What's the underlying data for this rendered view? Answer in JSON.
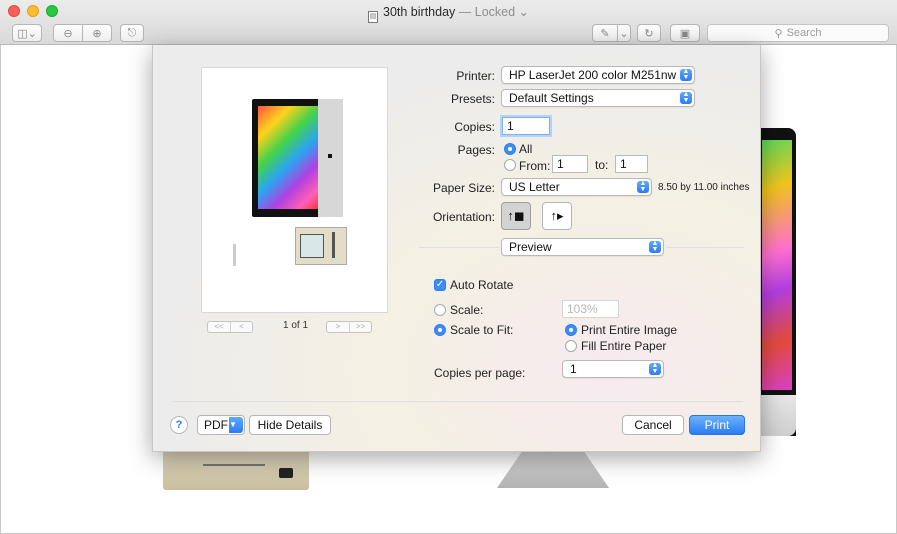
{
  "window": {
    "title": "30th birthday",
    "title_suffix": "— Locked ⌄",
    "search_placeholder": "Search"
  },
  "toolbar": {
    "sidebar_icon": "sidebar-icon",
    "zoom_out_icon": "zoom-out-icon",
    "zoom_in_icon": "zoom-in-icon",
    "share_icon": "share-icon",
    "markup_icon": "pen-icon",
    "rotate_icon": "rotate-icon",
    "toolbox_icon": "toolbox-icon"
  },
  "preview": {
    "page_count": "1 of 1",
    "first_page": "<<",
    "prev_page": "<",
    "next_page": ">",
    "last_page": ">>"
  },
  "print_dialog": {
    "printer_label": "Printer:",
    "printer_value": "HP LaserJet 200 color M251nw",
    "presets_label": "Presets:",
    "presets_value": "Default Settings",
    "copies_label": "Copies:",
    "copies_value": "1",
    "pages_label": "Pages:",
    "pages_all": "All",
    "pages_from_label": "From:",
    "pages_from_value": "1",
    "pages_to_label": "to:",
    "pages_to_value": "1",
    "paper_size_label": "Paper Size:",
    "paper_size_value": "US Letter",
    "paper_size_dimensions": "8.50 by 11.00 inches",
    "orientation_label": "Orientation:",
    "section_value": "Preview",
    "auto_rotate_label": "Auto Rotate",
    "scale_label": "Scale:",
    "scale_value": "103%",
    "scale_to_fit_label": "Scale to Fit:",
    "print_entire_image": "Print Entire Image",
    "fill_entire_paper": "Fill Entire Paper",
    "copies_per_page_label": "Copies per page:",
    "copies_per_page_value": "1",
    "help_label": "?",
    "pdf_label": "PDF",
    "hide_details_label": "Hide Details",
    "cancel_label": "Cancel",
    "print_label": "Print"
  },
  "colors": {
    "accent": "#3b8cf7",
    "close": "#fc5f57",
    "minimize": "#fdbc2e",
    "maximize": "#28c840"
  }
}
